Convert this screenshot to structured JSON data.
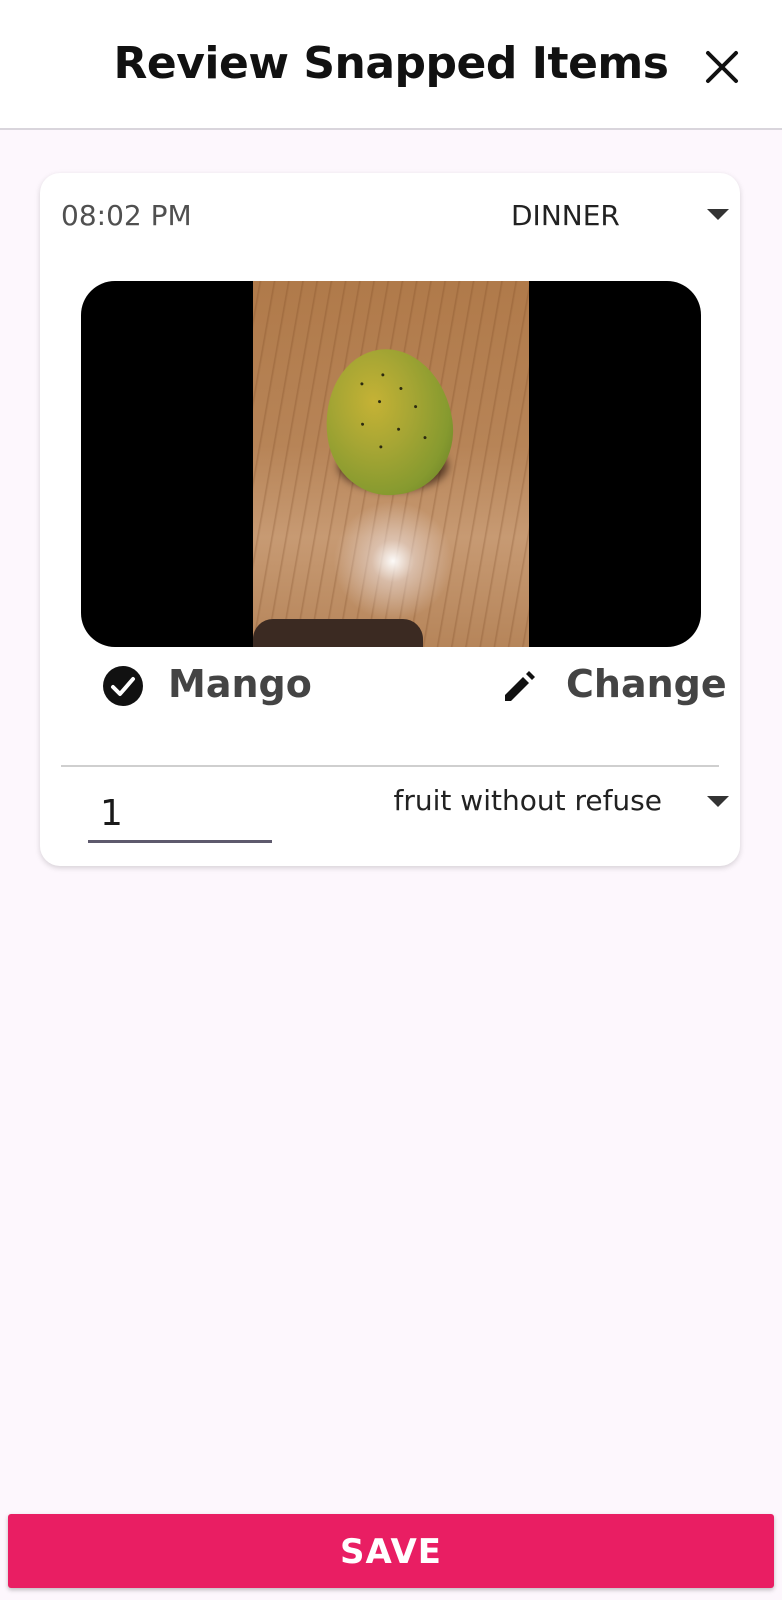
{
  "header": {
    "title": "Review Snapped Items",
    "close_icon": "close-icon"
  },
  "entry": {
    "time": "08:02 PM",
    "meal": "DINNER",
    "food_name": "Mango",
    "food_status_icon": "check-circle-icon",
    "change_label": "Change",
    "change_icon": "pencil-icon",
    "quantity": "1",
    "unit": "fruit without refuse"
  },
  "footer": {
    "save_label": "SAVE"
  },
  "colors": {
    "accent": "#e91e63",
    "background": "#fdf7fd",
    "text_primary": "#111111",
    "text_secondary": "#444444"
  }
}
